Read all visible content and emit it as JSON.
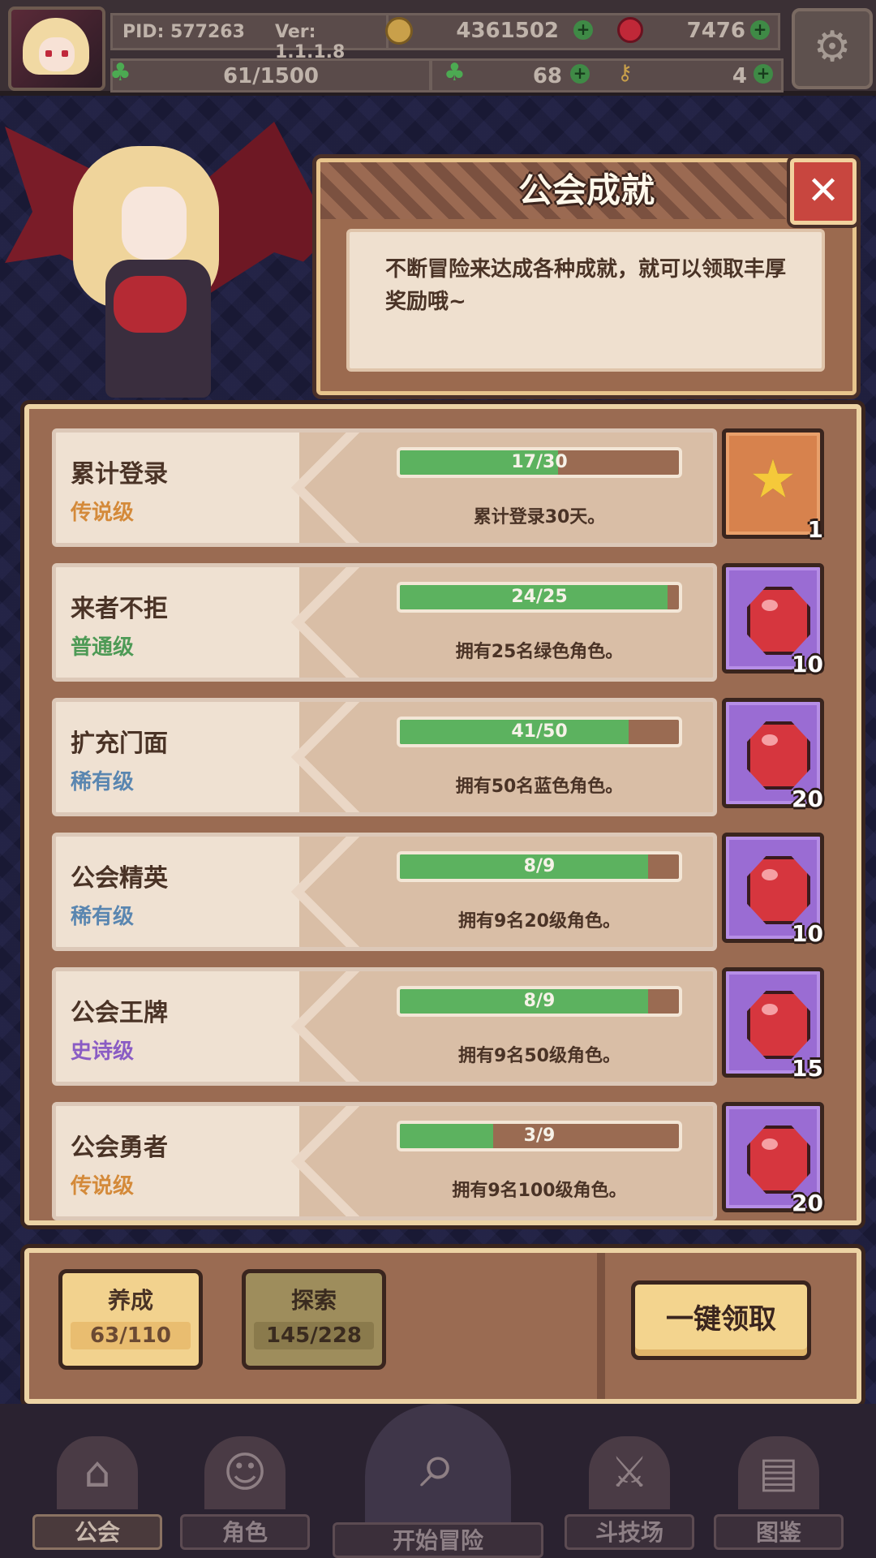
{
  "topbar": {
    "pid": "PID: 577263",
    "version": "Ver: 1.1.1.8",
    "gold": "4361502",
    "gems": "7476",
    "stamina": "61/1500",
    "clovers": "68",
    "keys": "4"
  },
  "header": {
    "title": "公会成就",
    "description": "不断冒险来达成各种成就，就可以领取丰厚奖励哦~"
  },
  "achievements": [
    {
      "name": "累计登录",
      "tier": "传说级",
      "tier_color": "#d48a3a",
      "progress_text": "17/30",
      "progress": 0.567,
      "desc": "累计登录30天。",
      "reward_type": "star",
      "reward_count": "1"
    },
    {
      "name": "来者不拒",
      "tier": "普通级",
      "tier_color": "#4e9a56",
      "progress_text": "24/25",
      "progress": 0.96,
      "desc": "拥有25名绿色角色。",
      "reward_type": "ruby",
      "reward_count": "10"
    },
    {
      "name": "扩充门面",
      "tier": "稀有级",
      "tier_color": "#5a86b0",
      "progress_text": "41/50",
      "progress": 0.82,
      "desc": "拥有50名蓝色角色。",
      "reward_type": "ruby",
      "reward_count": "20"
    },
    {
      "name": "公会精英",
      "tier": "稀有级",
      "tier_color": "#5a86b0",
      "progress_text": "8/9",
      "progress": 0.889,
      "desc": "拥有9名20级角色。",
      "reward_type": "ruby",
      "reward_count": "10"
    },
    {
      "name": "公会王牌",
      "tier": "史诗级",
      "tier_color": "#8a5cc4",
      "progress_text": "8/9",
      "progress": 0.889,
      "desc": "拥有9名50级角色。",
      "reward_type": "ruby",
      "reward_count": "15"
    },
    {
      "name": "公会勇者",
      "tier": "传说级",
      "tier_color": "#d48a3a",
      "progress_text": "3/9",
      "progress": 0.333,
      "desc": "拥有9名100级角色。",
      "reward_type": "ruby",
      "reward_count": "20"
    }
  ],
  "footer": {
    "train_label": "养成",
    "train_value": "63/110",
    "explore_label": "探索",
    "explore_value": "145/228",
    "claim_all": "一键领取"
  },
  "nav": {
    "guild": "公会",
    "character": "角色",
    "adventure": "开始冒险",
    "arena": "斗技场",
    "codex": "图鉴"
  }
}
